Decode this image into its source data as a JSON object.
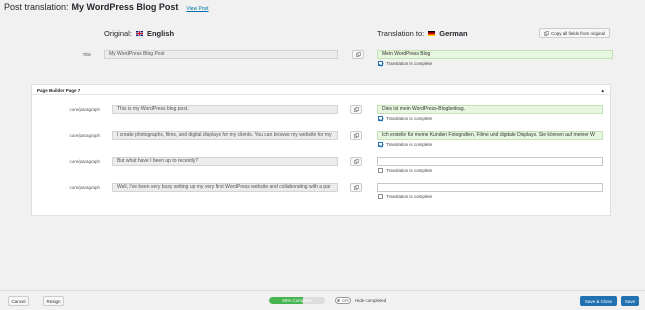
{
  "header": {
    "prefix": "Post translation:",
    "title": "My WordPress Blog Post",
    "view_link": "View Post"
  },
  "columns": {
    "original_prefix": "Original:",
    "original_lang": "English",
    "translation_prefix": "Translation to:",
    "translation_lang": "German"
  },
  "copy_all_label": "Copy all fields from original",
  "title_row": {
    "label": "Title",
    "original": "My WordPress Blog Post",
    "translation": "Mein WordPress Blog",
    "complete_label": "Translation is complete",
    "complete": true
  },
  "section": {
    "title": "Page Builder Page 7",
    "toggle_icon": "▲",
    "rows": [
      {
        "label": "core/paragraph",
        "original": "This is my WordPress blog post.",
        "translation": "Dies ist mein WordPress-Blogbeitrag.",
        "complete": true,
        "complete_label": "Translation is complete"
      },
      {
        "label": "core/paragraph",
        "original": "I create photographs, films, and digital displays for my clients. You can browse my website for my",
        "translation": "Ich erstelle für meine Kunden Fotografien, Filme und digitale Displays. Sie können auf meiner W",
        "complete": true,
        "complete_label": "Translation is complete"
      },
      {
        "label": "core/paragraph",
        "original": "But what have I been up to recently?",
        "translation": "",
        "complete": false,
        "complete_label": "Translation is complete"
      },
      {
        "label": "core/paragraph",
        "original": "Well, I've been very busy setting up my very first WordPress website and collaborating with a par",
        "translation": "",
        "complete": false,
        "complete_label": "Translation is complete"
      }
    ]
  },
  "footer": {
    "cancel": "Cancel",
    "resign": "Resign",
    "progress_label": "60% Complete",
    "progress_value": 0.6,
    "toggle_state": "OFF",
    "hide_completed": "Hide completed",
    "save_close": "Save & Close",
    "save": "Save"
  },
  "colors": {
    "accent": "#2271b1",
    "complete_bg": "#e6f6df",
    "progress": "#46b450"
  }
}
